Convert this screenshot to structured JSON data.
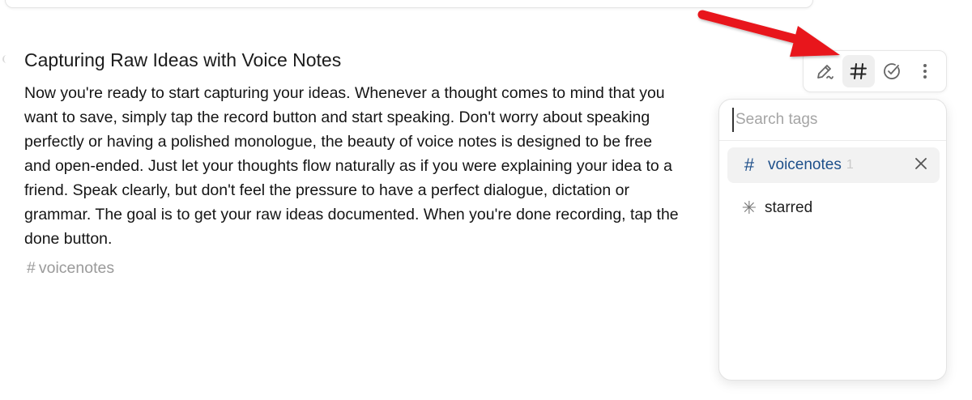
{
  "note": {
    "title": "Capturing Raw Ideas with Voice Notes",
    "body_lines": [
      "Now you're ready to start capturing your ideas. Whenever a thought comes to mind that you",
      "want to save, simply tap the record button and start speaking. Don't worry about speaking",
      "perfectly or having a polished monologue, the beauty of voice notes is designed to be free",
      "and open-ended. Just let your thoughts flow naturally as if you were explaining your idea to a",
      "friend. Speak clearly, but don't feel the pressure to have a perfect dialogue, dictation or",
      "grammar. The goal is to get your raw ideas documented. When you're done recording, tap the",
      "done button."
    ],
    "tag": {
      "hash": "#",
      "label": "voicenotes"
    }
  },
  "toolbar": {
    "buttons": [
      {
        "icon": "edit-pen-icon",
        "active": false
      },
      {
        "icon": "hashtag-icon",
        "active": true
      },
      {
        "icon": "check-circle-icon",
        "active": false
      },
      {
        "icon": "more-vertical-icon",
        "active": false
      }
    ]
  },
  "tags_popup": {
    "search_placeholder": "Search tags",
    "search_value": "",
    "items": [
      {
        "icon": "#",
        "label": "voicenotes",
        "count": "1",
        "selected": true
      },
      {
        "icon": "✳",
        "label": "starred",
        "count": "",
        "selected": false
      }
    ]
  },
  "colors": {
    "accent": "#1d4f8a",
    "annotation_arrow": "#e8141b",
    "muted_text": "#9a9a9a"
  }
}
